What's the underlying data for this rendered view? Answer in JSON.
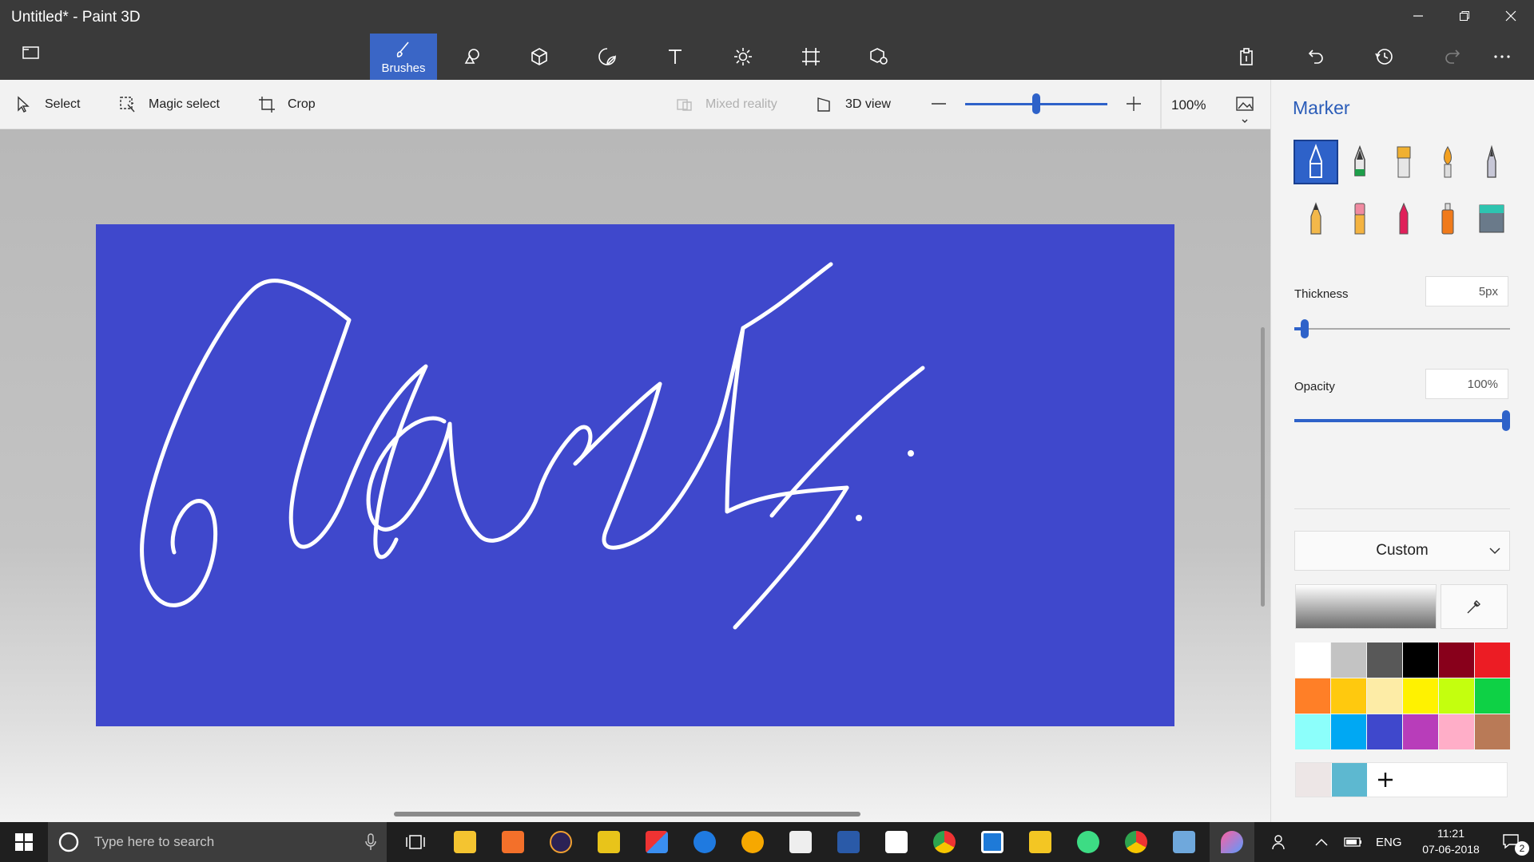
{
  "window": {
    "title": "Untitled* - Paint 3D"
  },
  "ribbon": {
    "brushes_label": "Brushes"
  },
  "commandbar": {
    "select": "Select",
    "magic_select": "Magic select",
    "crop": "Crop",
    "mixed_reality": "Mixed reality",
    "view_3d": "3D view",
    "zoom": "100%",
    "zoom_level": 0.5
  },
  "canvas": {
    "background": "#3f48cc",
    "ink": "#ffffff"
  },
  "panel": {
    "title": "Marker",
    "thickness_label": "Thickness",
    "thickness_value": "5px",
    "thickness_level": 0.03,
    "opacity_label": "Opacity",
    "opacity_value": "100%",
    "opacity_level": 1.0,
    "color_mode": "Custom",
    "palette": [
      "#ffffff",
      "#c3c3c3",
      "#585858",
      "#000000",
      "#88001b",
      "#ec1c24",
      "#ff7f27",
      "#ffc90e",
      "#fdeca6",
      "#fff200",
      "#c4ff0e",
      "#0ed145",
      "#8cfffb",
      "#00a8f3",
      "#3f48cc",
      "#b83dba",
      "#ffaec8",
      "#b97a57"
    ],
    "custom_colors": [
      "#ede6e6",
      "#5db8d0"
    ]
  },
  "taskbar": {
    "search_placeholder": "Type here to search",
    "language": "ENG",
    "time": "11:21",
    "date": "07-06-2018",
    "notifications": "2"
  }
}
